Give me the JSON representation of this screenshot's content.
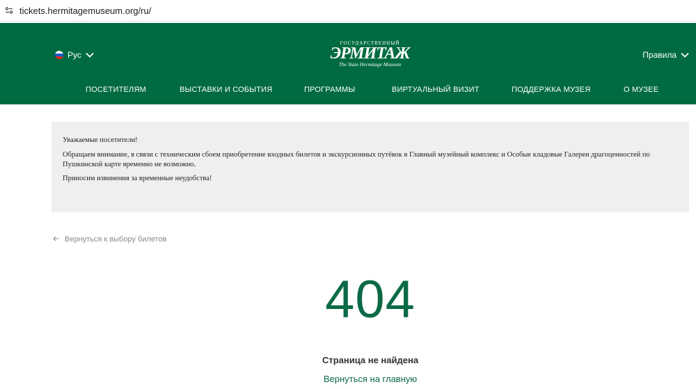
{
  "browser": {
    "url": "tickets.hermitagemuseum.org/ru/"
  },
  "header": {
    "lang_label": "Рус",
    "rules_label": "Правила",
    "logo": {
      "top": "ГОСУДАРСТВЕННЫЙ",
      "main": "ЭРМИТАЖ",
      "sub": "The State Hermitage Museum"
    },
    "nav": [
      "ПОСЕТИТЕЛЯМ",
      "ВЫСТАВКИ И СОБЫТИЯ",
      "ПРОГРАММЫ",
      "ВИРТУАЛЬНЫЙ ВИЗИТ",
      "ПОДДЕРЖКА МУЗЕЯ",
      "О МУЗЕЕ"
    ],
    "bg_color": "#006b40"
  },
  "notice": {
    "line1": "Уважаемые посетители!",
    "line2": "Обращаем внимание, в связи с техническим сбоем приобретение входных билетов и экскурсионных путёвок в Главный музейный комплекс и Особые кладовые Галереи драгоценностей по Пушкинской карте временно не возможно.",
    "line3": "Приносим извинения за временные неудобства!"
  },
  "back_link": "Вернуться к выбору билетов",
  "error": {
    "code": "404",
    "message": "Страница не найдена",
    "home_link": "Вернуться на главную",
    "accent_color": "#0b6a45"
  }
}
